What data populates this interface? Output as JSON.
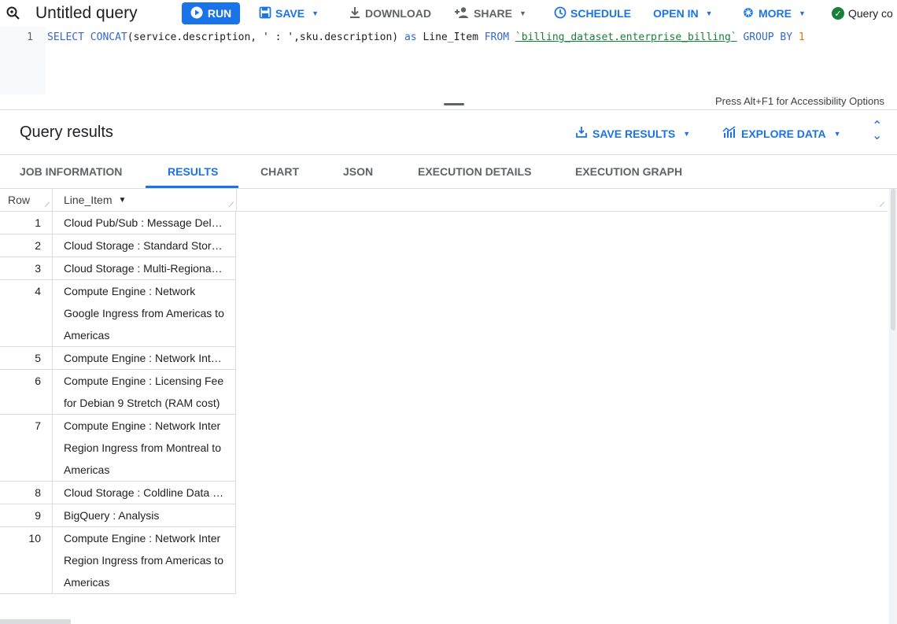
{
  "toolbar": {
    "title": "Untitled query",
    "run_label": "RUN",
    "save_label": "SAVE",
    "download_label": "DOWNLOAD",
    "share_label": "SHARE",
    "schedule_label": "SCHEDULE",
    "open_in_label": "OPEN IN",
    "more_label": "MORE",
    "status_text": "Query co"
  },
  "editor": {
    "line_number": "1",
    "sql": {
      "select": "SELECT",
      "concat": "CONCAT",
      "args": "(service.description, ' : ',sku.description)",
      "as": "as",
      "alias": "Line_Item",
      "from": "FROM",
      "table": "`billing_dataset.enterprise_billing`",
      "group_by": "GROUP BY",
      "group_num": "1"
    },
    "accessibility_hint": "Press Alt+F1 for Accessibility Options"
  },
  "results": {
    "title": "Query results",
    "save_results_label": "SAVE RESULTS",
    "explore_data_label": "EXPLORE DATA"
  },
  "tabs": [
    {
      "label": "JOB INFORMATION"
    },
    {
      "label": "RESULTS"
    },
    {
      "label": "CHART"
    },
    {
      "label": "JSON"
    },
    {
      "label": "EXECUTION DETAILS"
    },
    {
      "label": "EXECUTION GRAPH"
    }
  ],
  "table": {
    "columns": [
      "Row",
      "Line_Item"
    ],
    "rows": [
      {
        "row": "1",
        "line_item": "Cloud Pub/Sub : Message Deliv…"
      },
      {
        "row": "2",
        "line_item": "Cloud Storage : Standard Stora…"
      },
      {
        "row": "3",
        "line_item": "Cloud Storage : Multi-Regional …"
      },
      {
        "row": "4",
        "line_item": "Compute Engine : Network Google Ingress from Americas to Americas"
      },
      {
        "row": "5",
        "line_item": "Compute Engine : Network Intr…"
      },
      {
        "row": "6",
        "line_item": "Compute Engine : Licensing Fee for Debian 9 Stretch (RAM cost)"
      },
      {
        "row": "7",
        "line_item": "Compute Engine : Network Inter Region Ingress from Montreal to Americas"
      },
      {
        "row": "8",
        "line_item": "Cloud Storage : Coldline Data R…"
      },
      {
        "row": "9",
        "line_item": "BigQuery : Analysis"
      },
      {
        "row": "10",
        "line_item": "Compute Engine : Network Inter Region Ingress from Americas to Americas"
      }
    ]
  },
  "colors": {
    "accent": "#1a73e8",
    "success": "#188038",
    "keyword": "#3367d6",
    "number": "#e37400"
  }
}
